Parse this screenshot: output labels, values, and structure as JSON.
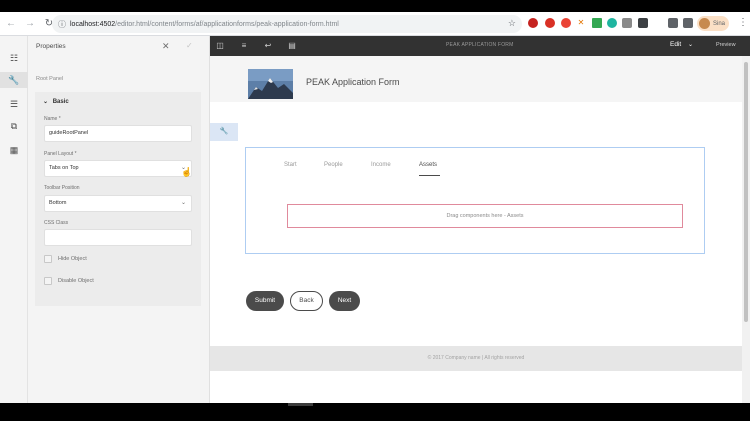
{
  "browser": {
    "url_host": "localhost:4502",
    "url_path": "/editor.html/content/forms/af/applicationforms/peak-application-form.html",
    "profile_name": "Sina",
    "extensions": [
      "ext-1",
      "ext-2",
      "ext-3",
      "ext-4",
      "ext-5",
      "ext-6",
      "ext-7",
      "ext-8",
      "ext-9"
    ]
  },
  "rail": {
    "icons": [
      "layers-icon",
      "wrench-icon",
      "tree-icon",
      "copy-icon",
      "assets-icon"
    ]
  },
  "properties": {
    "title": "Properties",
    "subtitle": "Root Panel",
    "section": "Basic",
    "name_label": "Name *",
    "name_value": "guideRootPanel",
    "layout_label": "Panel Layout *",
    "layout_value": "Tabs on Top",
    "toolbar_label": "Toolbar Position",
    "toolbar_value": "Bottom",
    "css_label": "CSS Class",
    "css_value": "",
    "hide_label": "Hide Object",
    "disable_label": "Disable Object"
  },
  "editor": {
    "header_title": "PEAK APPLICATION FORM",
    "mode": "Edit",
    "preview": "Preview"
  },
  "form": {
    "title": "PEAK Application Form",
    "tabs": [
      "Start",
      "People",
      "Income",
      "Assets"
    ],
    "active_tab": "Assets",
    "drop_text": "Drag components here - Assets",
    "buttons": {
      "submit": "Submit",
      "back": "Back",
      "next": "Next"
    },
    "footer": "© 2017 Company name | All rights reserved"
  }
}
